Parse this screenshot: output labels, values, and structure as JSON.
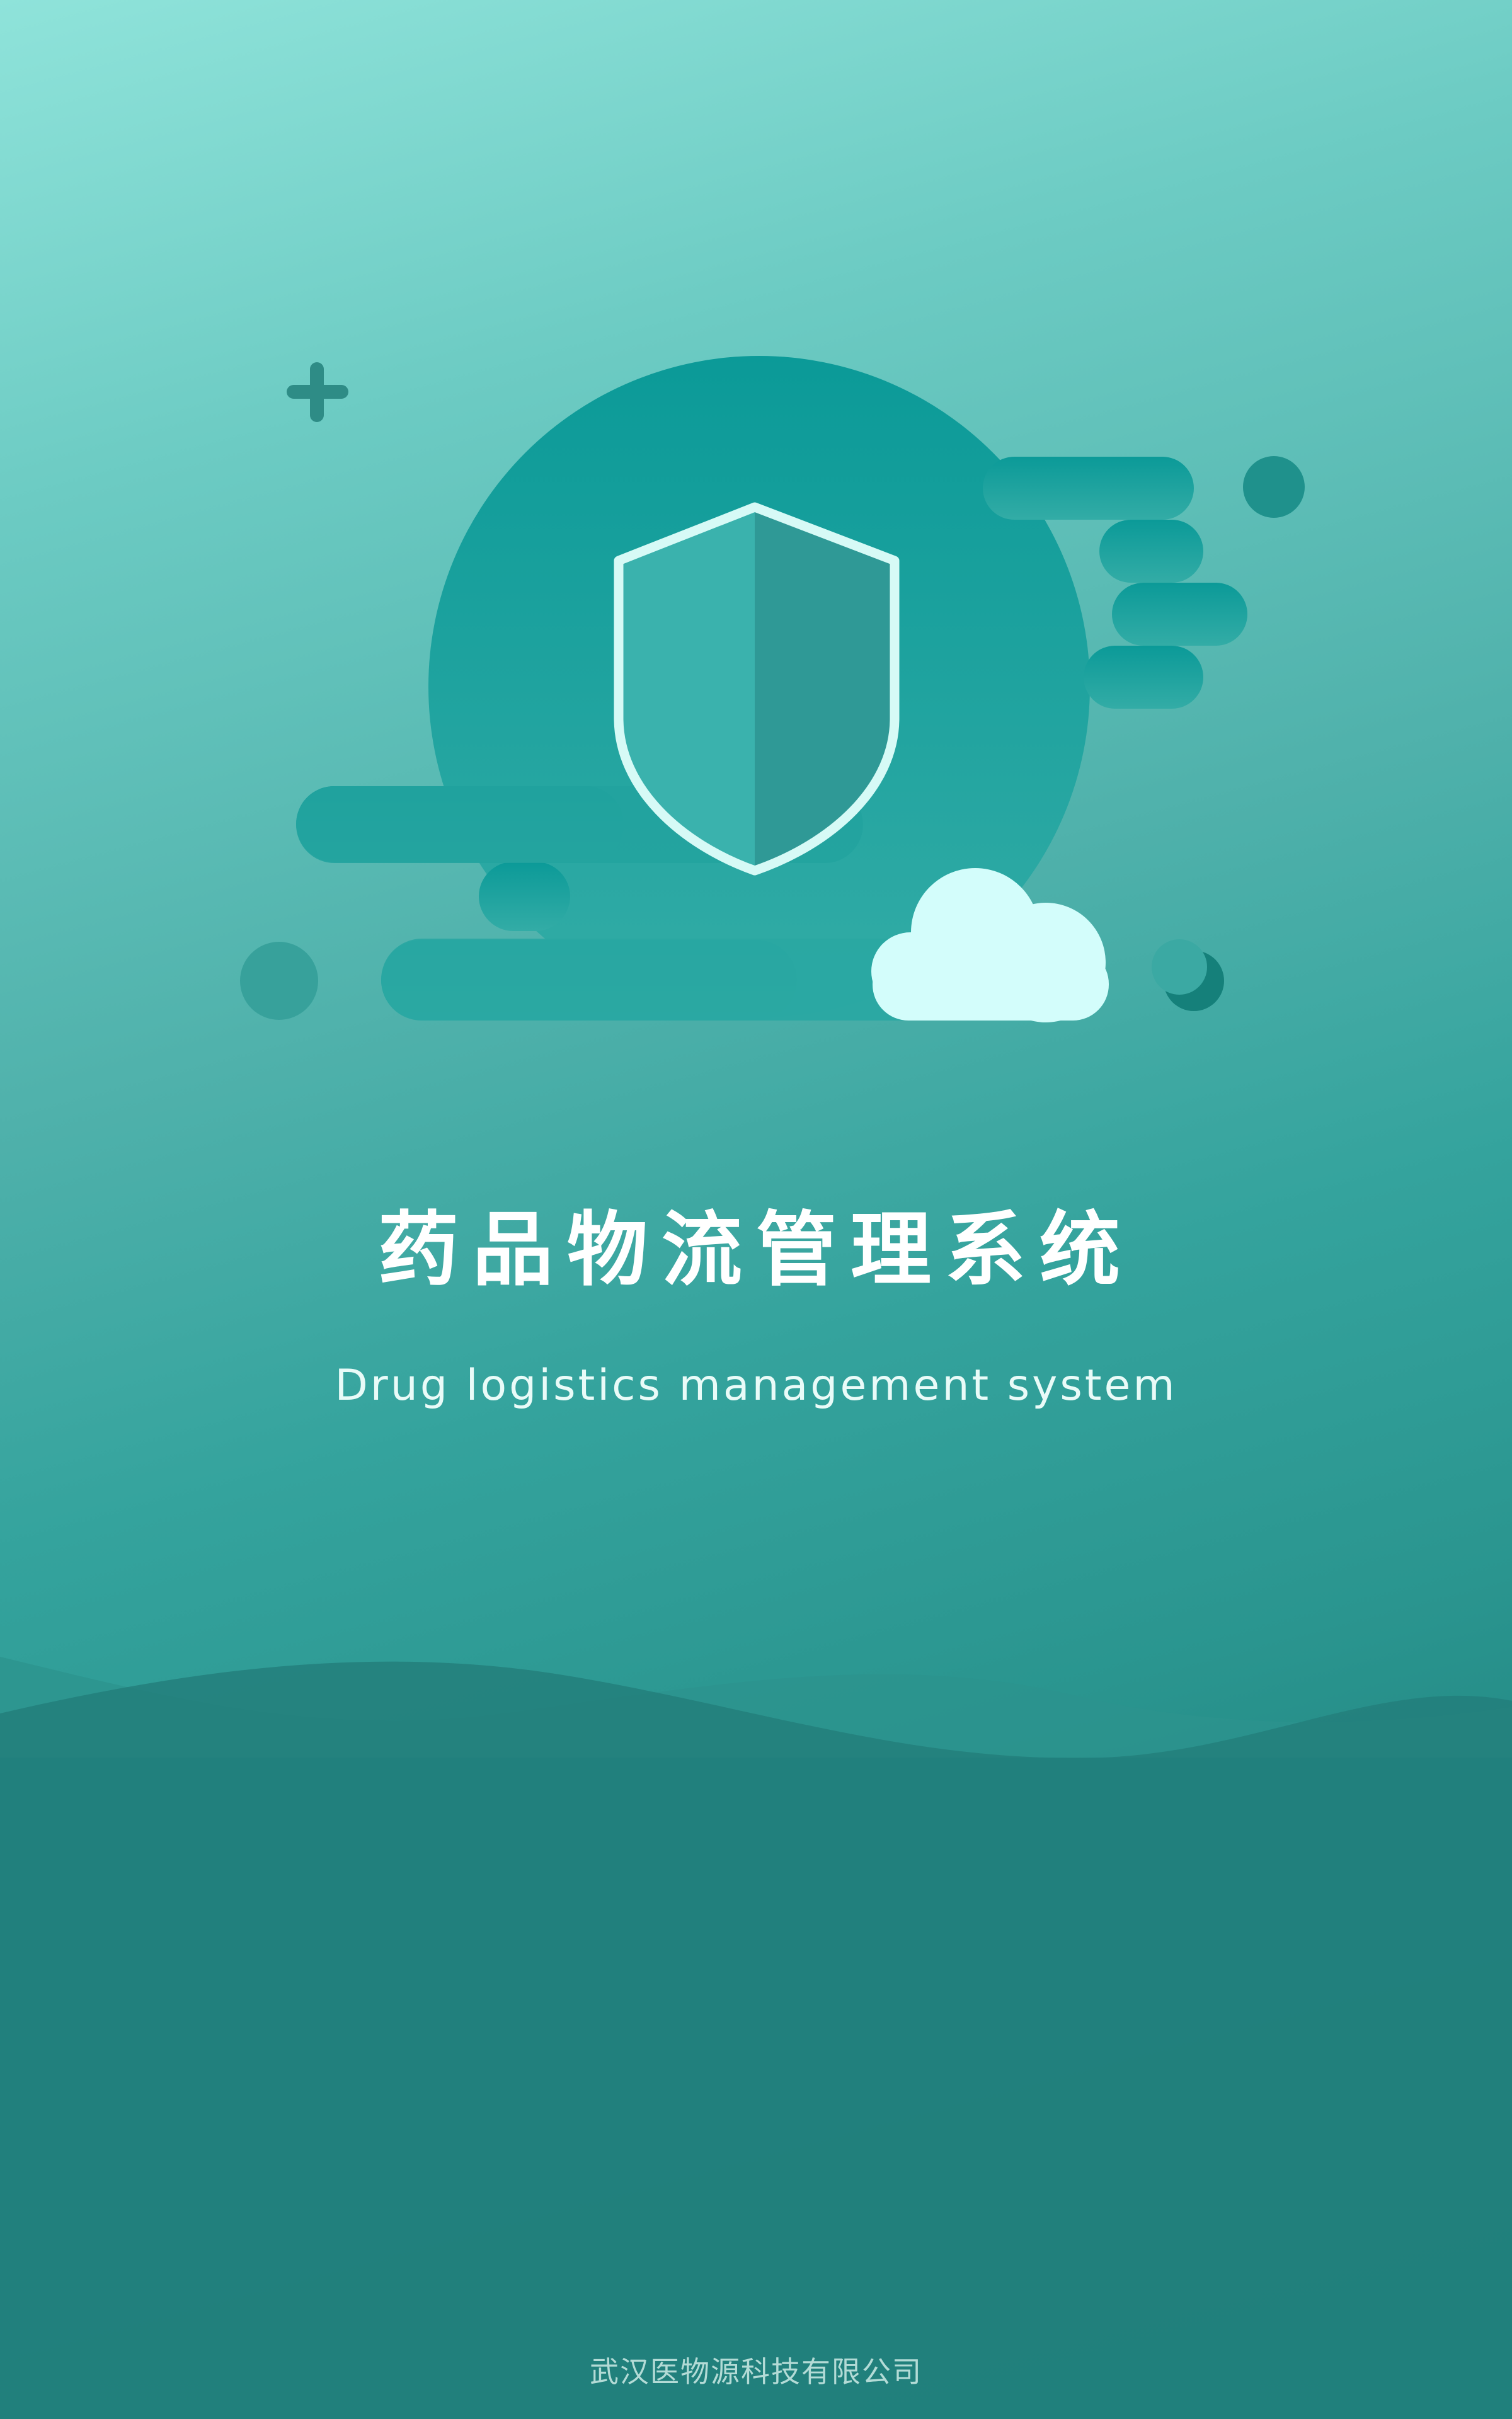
{
  "splash": {
    "title": "药品物流管理系统",
    "subtitle": "Drug logistics management system",
    "company": "武汉医物源科技有限公司"
  },
  "icons": [
    "plus-icon",
    "shield-icon",
    "cloud-icon",
    "moon-icon"
  ],
  "colors": {
    "background_top": "#8fe3da",
    "background_bottom": "#197a76",
    "shield_outline": "#d6faf6",
    "cloud": "#d3fdfb",
    "moon": "#15807a"
  }
}
